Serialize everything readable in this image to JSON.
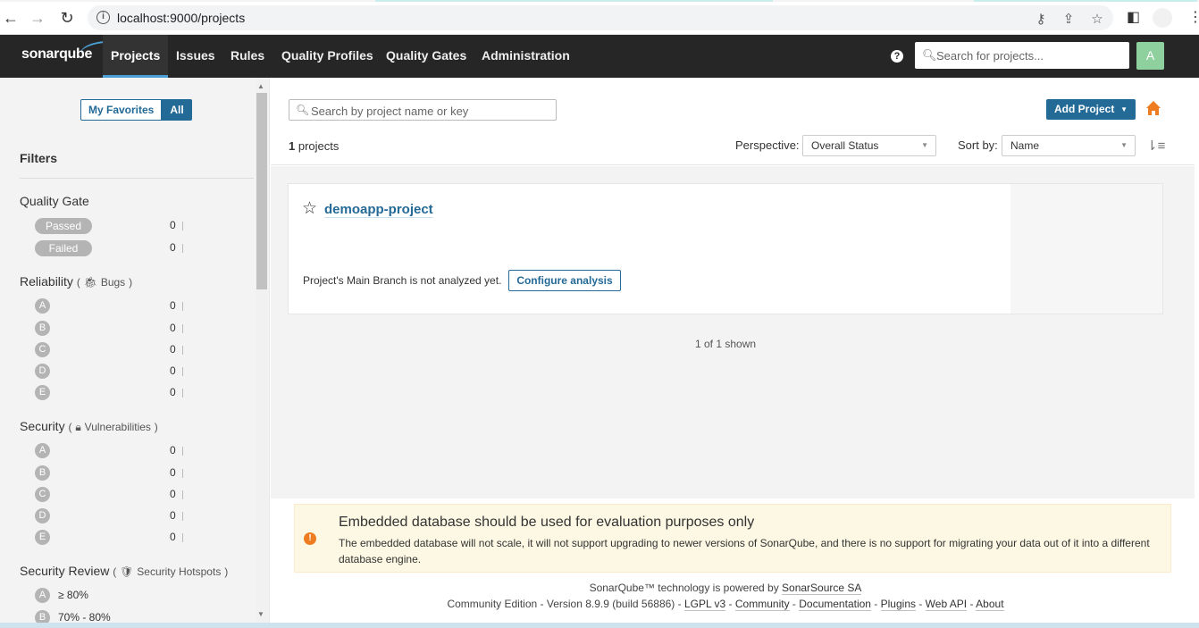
{
  "browser": {
    "url": "localhost:9000/projects"
  },
  "header": {
    "logo": "sonarqube",
    "nav": [
      "Projects",
      "Issues",
      "Rules",
      "Quality Profiles",
      "Quality Gates",
      "Administration"
    ],
    "search_placeholder": "Search for projects...",
    "avatar": "A",
    "help": "?"
  },
  "sidebar": {
    "my_favorites": "My Favorites",
    "all": "All",
    "filters_title": "Filters",
    "quality_gate": {
      "title": "Quality Gate",
      "items": [
        {
          "label": "Passed",
          "count": "0"
        },
        {
          "label": "Failed",
          "count": "0"
        }
      ]
    },
    "reliability": {
      "title": "Reliability",
      "sub": "Bugs",
      "items": [
        {
          "label": "A",
          "count": "0"
        },
        {
          "label": "B",
          "count": "0"
        },
        {
          "label": "C",
          "count": "0"
        },
        {
          "label": "D",
          "count": "0"
        },
        {
          "label": "E",
          "count": "0"
        }
      ]
    },
    "security": {
      "title": "Security",
      "sub": "Vulnerabilities",
      "items": [
        {
          "label": "A",
          "count": "0"
        },
        {
          "label": "B",
          "count": "0"
        },
        {
          "label": "C",
          "count": "0"
        },
        {
          "label": "D",
          "count": "0"
        },
        {
          "label": "E",
          "count": "0"
        }
      ]
    },
    "security_review": {
      "title": "Security Review",
      "sub": "Security Hotspots",
      "items": [
        {
          "label": "A",
          "text": "≥ 80%"
        },
        {
          "label": "B",
          "text": "70% - 80%"
        }
      ]
    },
    "paren_open": "(",
    "paren_close": ")"
  },
  "main": {
    "search_placeholder": "Search by project name or key",
    "add_project": "Add Project",
    "project_count_number": "1",
    "project_count_label": " projects",
    "perspective_label": "Perspective:",
    "perspective_value": "Overall Status",
    "sort_label": "Sort by:",
    "sort_value": "Name",
    "project": {
      "name": "demoapp-project",
      "status": "Project's Main Branch is not analyzed yet.",
      "configure": "Configure analysis"
    },
    "shown": "1 of 1 shown"
  },
  "warning": {
    "title": "Embedded database should be used for evaluation purposes only",
    "text": "The embedded database will not scale, it will not support upgrading to newer versions of SonarQube, and there is no support for migrating your data out of it into a different database engine."
  },
  "footer": {
    "powered_prefix": "SonarQube™ technology is powered by ",
    "powered_link": "SonarSource SA",
    "edition": "Community Edition",
    "version": "Version 8.9.9 (build 56886)",
    "license": "LGPL v3",
    "community": "Community",
    "documentation": "Documentation",
    "plugins": "Plugins",
    "web_api": "Web API",
    "about": "About",
    "sep": " - "
  }
}
